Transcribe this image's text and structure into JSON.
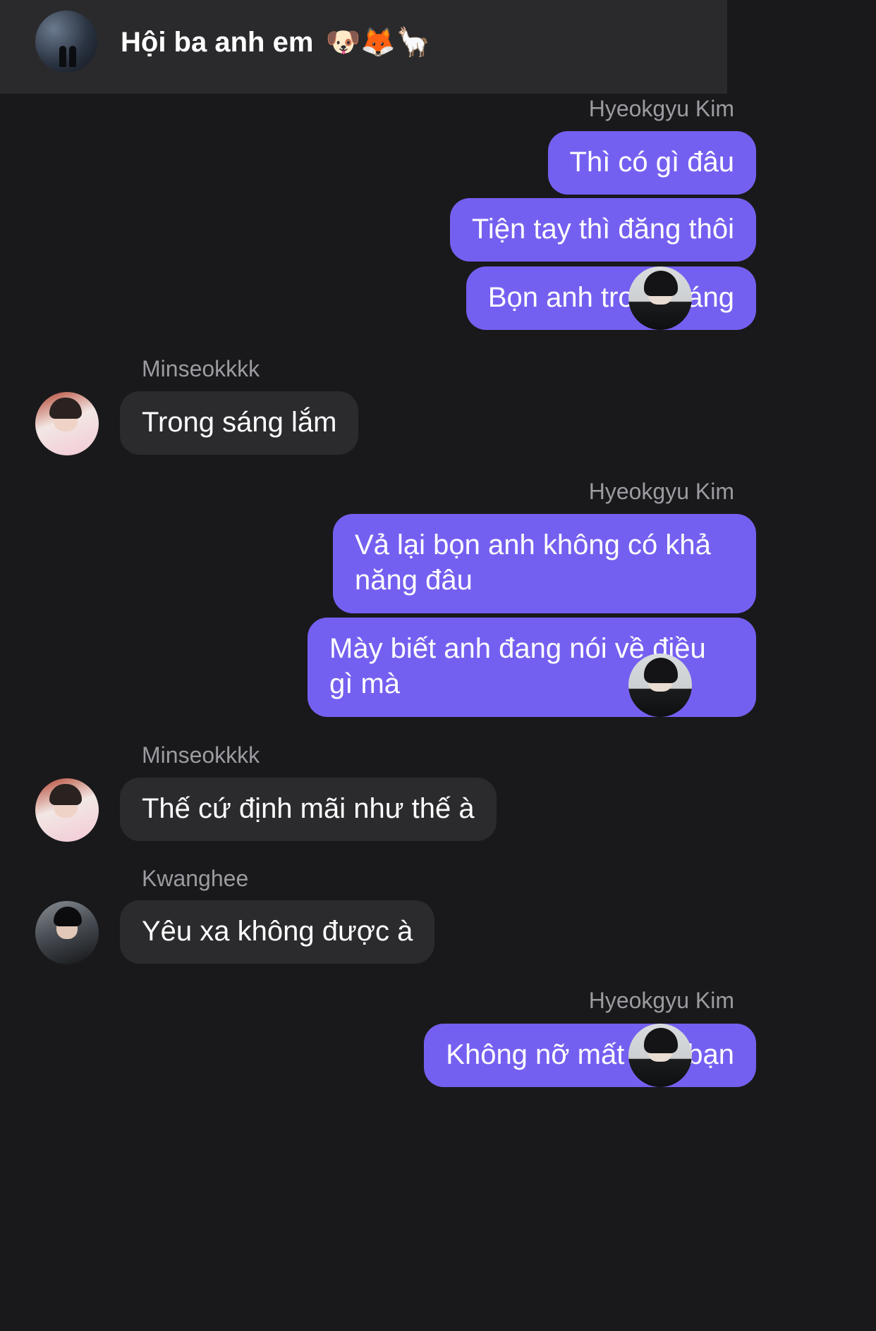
{
  "header": {
    "title": "Hội ba anh em",
    "emojis": "🐶🦊🦙"
  },
  "messages": [
    {
      "sender": "Hyeokgyu Kim",
      "texts": [
        "Thì có gì đâu",
        "Tiện tay thì đăng thôi",
        "Bọn anh trong sáng"
      ]
    },
    {
      "sender": "Minseokkkk",
      "texts": [
        "Trong sáng lắm"
      ]
    },
    {
      "sender": "Hyeokgyu Kim",
      "texts": [
        "Vả lại bọn anh không có khả năng đâu",
        "Mày biết anh đang nói về điều gì mà"
      ]
    },
    {
      "sender": "Minseokkkk",
      "texts": [
        "Thế cứ định mãi như thế à"
      ]
    },
    {
      "sender": "Kwanghee",
      "texts": [
        "Yêu xa không được à"
      ]
    },
    {
      "sender": "Hyeokgyu Kim",
      "texts": [
        "Không nỡ mất tình bạn"
      ]
    }
  ],
  "colors": {
    "background": "#19191b",
    "header": "#2a2a2c",
    "my_bubble": "#7460f0",
    "other_bubble": "#2b2b2e",
    "sender_name": "#9b9ba1"
  }
}
